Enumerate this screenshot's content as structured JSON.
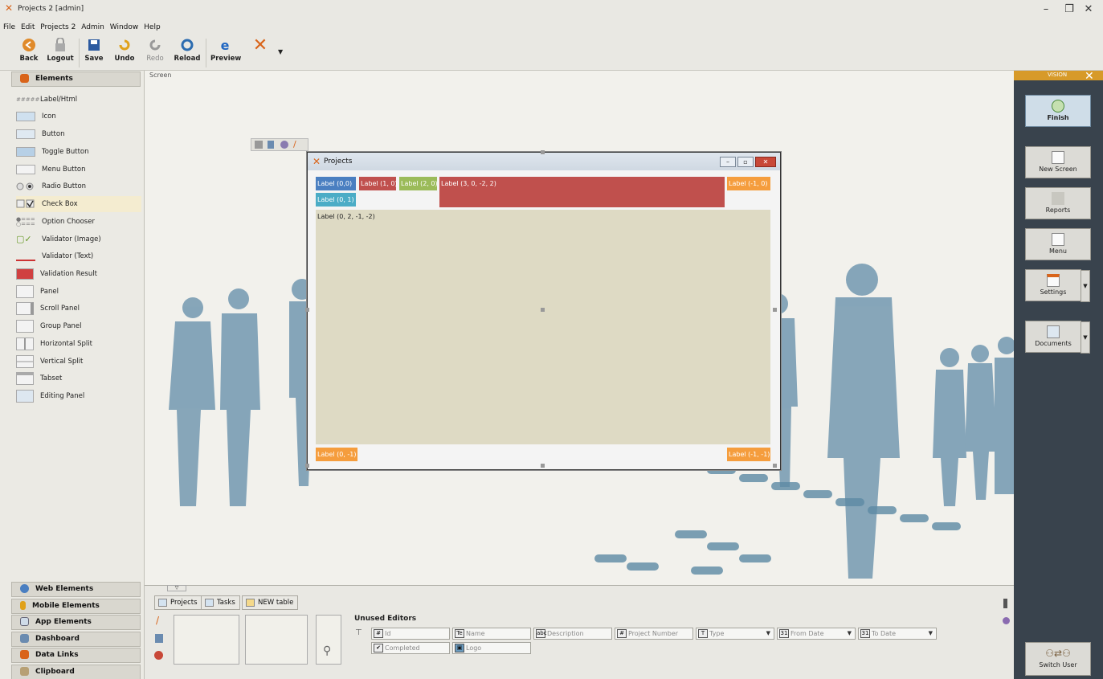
{
  "window": {
    "title": "Projects 2 [admin]",
    "controls": [
      "–",
      "❐",
      "✕"
    ]
  },
  "menu": [
    "File",
    "Edit",
    "Projects 2",
    "Admin",
    "Window",
    "Help"
  ],
  "toolbar": {
    "back": "Back",
    "logout": "Logout",
    "save": "Save",
    "undo": "Undo",
    "redo": "Redo",
    "reload": "Reload",
    "preview": "Preview"
  },
  "left_panel": {
    "elements_header": "Elements",
    "items": [
      "Label/Html",
      "Icon",
      "Button",
      "Toggle Button",
      "Menu Button",
      "Radio Button",
      "Check Box",
      "Option Chooser",
      "Validator (Image)",
      "Validator (Text)",
      "Validation Result",
      "Panel",
      "Scroll Panel",
      "Group Panel",
      "Horizontal Split",
      "Vertical Split",
      "Tabset",
      "Editing Panel"
    ],
    "selected_item": "Check Box",
    "sections": [
      "Web Elements",
      "Mobile Elements",
      "App Elements",
      "Dashboard",
      "Data Links",
      "Clipboard"
    ]
  },
  "canvas": {
    "screen_label": "Screen",
    "window_title": "Projects",
    "labels": {
      "l00": "Label (0,0)",
      "l10": "Label (1, 0)",
      "l20": "Label (2, 0)",
      "l30": "Label (3, 0, -2, 2)",
      "lm10": "Label (-1, 0)",
      "l01": "Label (0, 1)",
      "l02": "Label (0, 2, -1, -2)",
      "l0m1": "Label (0, -1)",
      "lm1m1": "Label (-1, -1)"
    }
  },
  "right_panel": {
    "vision_label": "VISION",
    "finish": "Finish",
    "new_screen": "New Screen",
    "reports": "Reports",
    "menu": "Menu",
    "settings": "Settings",
    "documents": "Documents",
    "switch_user": "Switch User"
  },
  "bottom": {
    "tabs": [
      "Projects",
      "Tasks",
      "NEW table"
    ],
    "unused_editors_title": "Unused Editors",
    "fields": [
      {
        "icon": "#",
        "label": "Id"
      },
      {
        "icon": "Te",
        "label": "Name"
      },
      {
        "icon": "abc",
        "label": "Description"
      },
      {
        "icon": "#",
        "label": "Project Number"
      },
      {
        "icon": "T",
        "label": "Type"
      },
      {
        "icon": "31",
        "label": "From Date"
      },
      {
        "icon": "31",
        "label": "To Date"
      },
      {
        "icon": "✔",
        "label": "Completed"
      },
      {
        "icon": "▣",
        "label": "Logo"
      }
    ]
  },
  "colors": {
    "blue": "#4a7fc1",
    "red": "#c0504d",
    "green": "#9bbb59",
    "orange": "#f59d3d",
    "teal": "#4bacc6",
    "sand": "#dedac4",
    "accent": "#d9641a"
  }
}
